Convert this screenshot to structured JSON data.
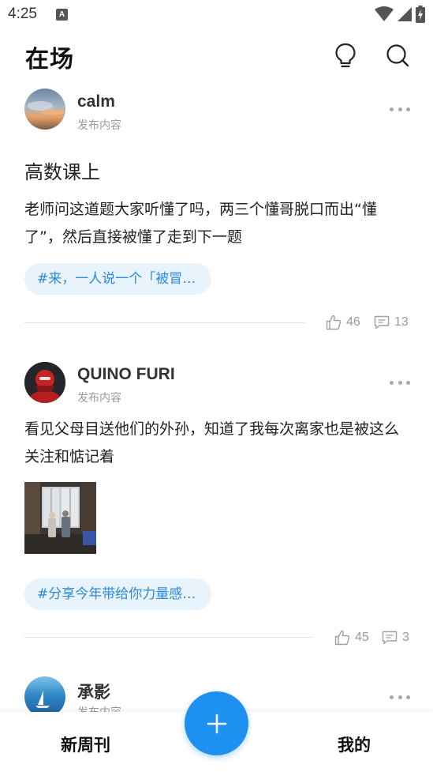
{
  "status_bar": {
    "time": "4:25",
    "notification_letter": "A"
  },
  "app": {
    "title": "在场"
  },
  "posts": [
    {
      "author": "calm",
      "subtitle": "发布内容",
      "title": "高数课上",
      "body": "老师问这道题大家听懂了吗，两三个懂哥脱口而出“懂了”，然后直接被懂了走到下一题",
      "tag": "#来，一人说一个「被冒…",
      "likes": "46",
      "comments": "13"
    },
    {
      "author": "QUINO FURI",
      "subtitle": "发布内容",
      "body": "看见父母目送他们的外孙，知道了我每次离家也是被这么关注和惦记着",
      "tag": "#分享今年带给你力量感…",
      "likes": "45",
      "comments": "3"
    },
    {
      "author": "承影",
      "subtitle": "发布内容"
    }
  ],
  "bottom_nav": {
    "left": "新周刊",
    "right": "我的"
  },
  "colors": {
    "accent": "#1e90f0",
    "tag_bg": "#e9f3fb",
    "tag_text": "#2b8ad8"
  }
}
